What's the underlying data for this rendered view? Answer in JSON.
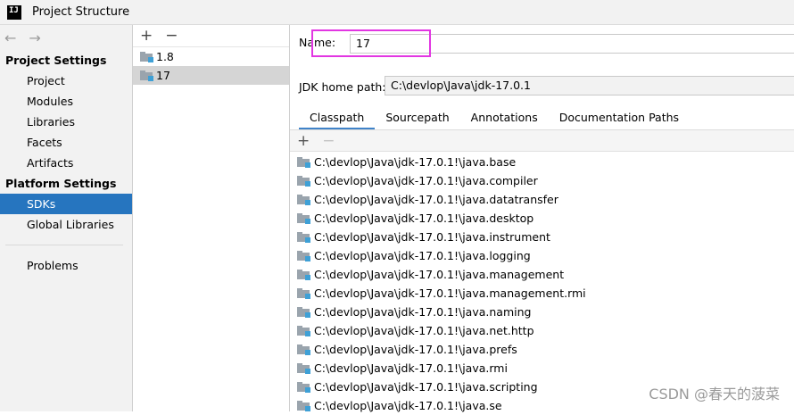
{
  "window": {
    "title": "Project Structure",
    "logo_text": "IJ"
  },
  "nav": {
    "back_glyph": "←",
    "forward_glyph": "→",
    "project_settings_header": "Project Settings",
    "project_items": [
      "Project",
      "Modules",
      "Libraries",
      "Facets",
      "Artifacts"
    ],
    "platform_settings_header": "Platform Settings",
    "platform_items": [
      "SDKs",
      "Global Libraries"
    ],
    "problems": "Problems"
  },
  "sdk_list": {
    "add_glyph": "+",
    "remove_glyph": "−",
    "items": [
      "1.8",
      "17"
    ],
    "selected": "17"
  },
  "detail": {
    "name_label": "Name:",
    "name_value": "17",
    "jdk_home_label": "JDK home path:",
    "jdk_home_value": "C:\\devlop\\Java\\jdk-17.0.1",
    "tabs": [
      "Classpath",
      "Sourcepath",
      "Annotations",
      "Documentation Paths"
    ],
    "active_tab": "Classpath",
    "add_glyph": "+",
    "remove_glyph": "−",
    "classpath": [
      "C:\\devlop\\Java\\jdk-17.0.1!\\java.base",
      "C:\\devlop\\Java\\jdk-17.0.1!\\java.compiler",
      "C:\\devlop\\Java\\jdk-17.0.1!\\java.datatransfer",
      "C:\\devlop\\Java\\jdk-17.0.1!\\java.desktop",
      "C:\\devlop\\Java\\jdk-17.0.1!\\java.instrument",
      "C:\\devlop\\Java\\jdk-17.0.1!\\java.logging",
      "C:\\devlop\\Java\\jdk-17.0.1!\\java.management",
      "C:\\devlop\\Java\\jdk-17.0.1!\\java.management.rmi",
      "C:\\devlop\\Java\\jdk-17.0.1!\\java.naming",
      "C:\\devlop\\Java\\jdk-17.0.1!\\java.net.http",
      "C:\\devlop\\Java\\jdk-17.0.1!\\java.prefs",
      "C:\\devlop\\Java\\jdk-17.0.1!\\java.rmi",
      "C:\\devlop\\Java\\jdk-17.0.1!\\java.scripting",
      "C:\\devlop\\Java\\jdk-17.0.1!\\java.se"
    ]
  },
  "watermark": "CSDN @春天的菠菜",
  "colors": {
    "selection": "#2675bf",
    "highlight_box": "#e236e2",
    "tab_underline": "#4083c9"
  }
}
